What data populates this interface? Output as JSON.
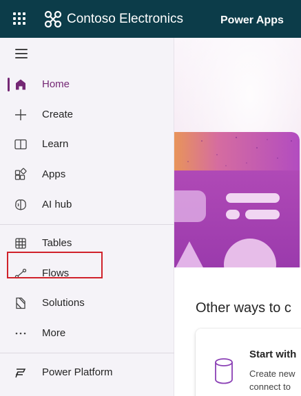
{
  "header": {
    "org_name": "Contoso Electronics",
    "app_name": "Power Apps",
    "background_color": "#0c3c49",
    "waffle_icon": "app-launcher-icon",
    "logo_icon": "contoso-logo-icon"
  },
  "sidebar": {
    "menu_icon": "hamburger-icon",
    "accent_color": "#742774",
    "items": [
      {
        "label": "Home",
        "icon": "home-icon",
        "selected": true
      },
      {
        "label": "Create",
        "icon": "plus-icon"
      },
      {
        "label": "Learn",
        "icon": "book-icon"
      },
      {
        "label": "Apps",
        "icon": "apps-icon"
      },
      {
        "label": "AI hub",
        "icon": "brain-icon"
      },
      {
        "label": "Tables",
        "icon": "table-icon"
      },
      {
        "label": "Flows",
        "icon": "flow-icon"
      },
      {
        "label": "Solutions",
        "icon": "solutions-icon",
        "highlighted": true
      },
      {
        "label": "More",
        "icon": "more-icon"
      },
      {
        "label": "Power Platform",
        "icon": "power-platform-icon"
      }
    ],
    "highlight_color": "#d0212a"
  },
  "main": {
    "section_title": "Other ways to c",
    "card": {
      "title": "Start with",
      "description_line1": "Create new",
      "description_line2": "connect to",
      "icon": "database-icon"
    }
  }
}
